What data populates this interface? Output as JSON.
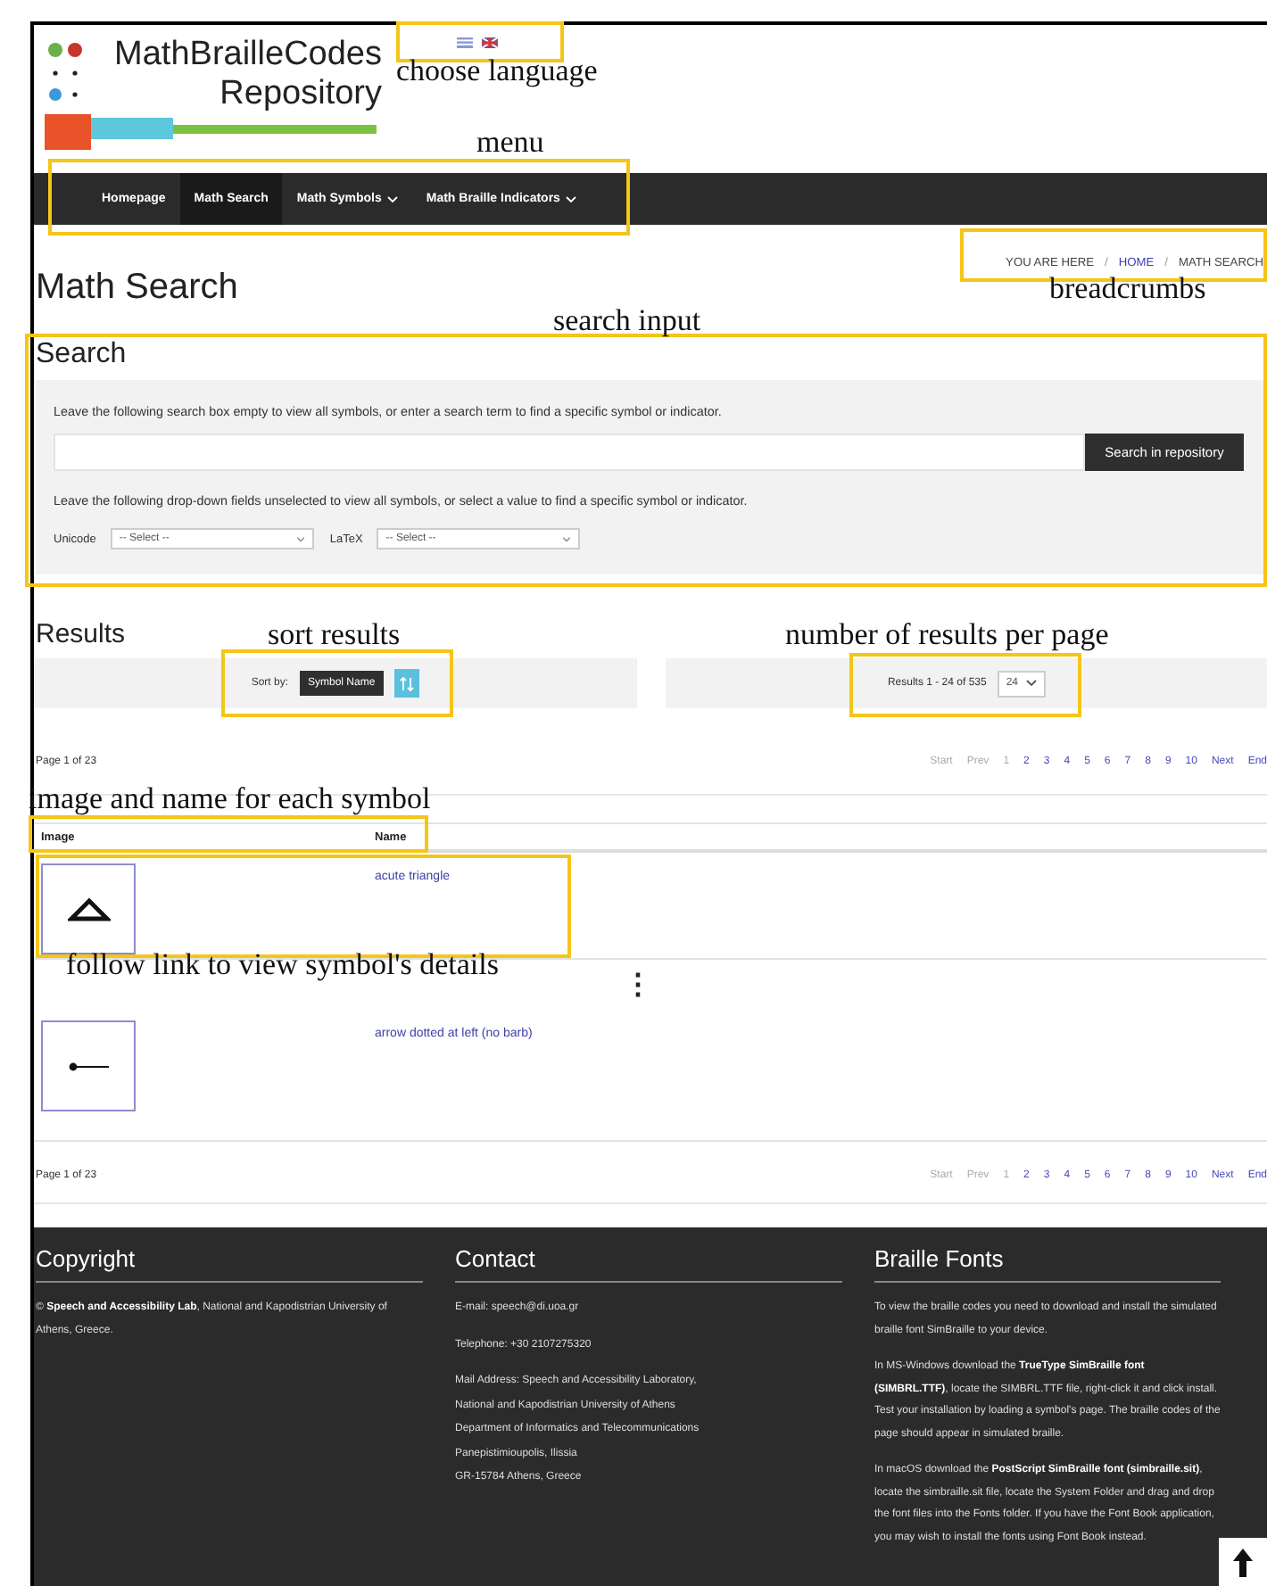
{
  "header": {
    "logo_line_1": "MathBrailleCodes",
    "logo_line_2": "Repository"
  },
  "nav": {
    "items": [
      {
        "label": "Homepage",
        "selected": false,
        "dropdown": false
      },
      {
        "label": "Math Search",
        "selected": true,
        "dropdown": false
      },
      {
        "label": "Math Symbols",
        "selected": false,
        "dropdown": true
      },
      {
        "label": "Math Braille Indicators",
        "selected": false,
        "dropdown": true
      }
    ]
  },
  "breadcrumbs": {
    "prefix": "YOU ARE HERE",
    "items": [
      {
        "label": "/",
        "kind": "separator"
      },
      {
        "label": "HOME",
        "kind": "link"
      },
      {
        "label": "/",
        "kind": "separator"
      },
      {
        "label": "MATH SEARCH",
        "kind": "current"
      }
    ]
  },
  "page_title": "Math Search",
  "search": {
    "title": "Search",
    "hint_1": "Leave the following search box empty to view all symbols, or enter a search term to find a specific symbol or indicator.",
    "button": "Search in repository",
    "hint_2": "Leave the following drop-down fields unselected to view all symbols, or select a value to find a specific symbol or indicator.",
    "filters": [
      {
        "label": "Unicode",
        "value": "-- Select --"
      },
      {
        "label": "LaTeX",
        "value": "-- Select --"
      }
    ]
  },
  "results": {
    "title": "Results",
    "sort_label": "Sort by:",
    "sort_button": "Symbol Name",
    "count": "Results 1 - 24 of 535",
    "per_page": "24",
    "pager_top": {
      "page_info": "Page 1 of 23",
      "items": [
        {
          "label": "Start",
          "disabled": true
        },
        {
          "label": "Prev",
          "disabled": true
        },
        {
          "label": "1",
          "disabled": true
        },
        {
          "label": "2",
          "disabled": false
        },
        {
          "label": "3",
          "disabled": false
        },
        {
          "label": "4",
          "disabled": false
        },
        {
          "label": "5",
          "disabled": false
        },
        {
          "label": "6",
          "disabled": false
        },
        {
          "label": "7",
          "disabled": false
        },
        {
          "label": "8",
          "disabled": false
        },
        {
          "label": "9",
          "disabled": false
        },
        {
          "label": "10",
          "disabled": false
        },
        {
          "label": "Next",
          "disabled": false
        },
        {
          "label": "End",
          "disabled": false
        }
      ]
    },
    "columns": [
      "Image",
      "Name"
    ],
    "rows": [
      {
        "name": "acute triangle"
      },
      {
        "name": "arrow dotted at left (no barb)"
      }
    ],
    "more_rows_marker": "⋮",
    "pager_bottom": {
      "page_info": "Page 1 of 23",
      "items": [
        {
          "label": "Start",
          "disabled": true
        },
        {
          "label": "Prev",
          "disabled": true
        },
        {
          "label": "1",
          "disabled": true
        },
        {
          "label": "2",
          "disabled": false
        },
        {
          "label": "3",
          "disabled": false
        },
        {
          "label": "4",
          "disabled": false
        },
        {
          "label": "5",
          "disabled": false
        },
        {
          "label": "6",
          "disabled": false
        },
        {
          "label": "7",
          "disabled": false
        },
        {
          "label": "8",
          "disabled": false
        },
        {
          "label": "9",
          "disabled": false
        },
        {
          "label": "10",
          "disabled": false
        },
        {
          "label": "Next",
          "disabled": false
        },
        {
          "label": "End",
          "disabled": false
        }
      ]
    }
  },
  "footer": {
    "copyright": {
      "title": "Copyright",
      "text": "© **Speech and Accessibility Lab**, National and Kapodistrian University of Athens, Greece."
    },
    "contact": {
      "title": "Contact",
      "email": "E-mail: speech@di.uoa.gr",
      "telephone": "Telephone: +30 2107275320",
      "address_lines": [
        "Mail Address: Speech and Accessibility Laboratory,",
        "National and Kapodistrian University of Athens",
        "Department of Informatics and Telecommunications",
        "Panepistimioupolis, Ilissia",
        "GR-15784 Athens, Greece"
      ]
    },
    "fonts": {
      "title": "Braille Fonts",
      "paragraphs": [
        "To view the braille codes you need to download and install the simulated braille font SimBraille to your device.",
        "In MS-Windows download the **TrueType SimBraille font (SIMBRL.TTF)**, locate the SIMBRL.TTF file, right-click it and click install. Test your installation by loading a symbol's page. The braille codes of the page should appear in simulated braille.",
        "In macOS download the **PostScript SimBraille font (simbraille.sit)**, locate the simbraille.sit file, locate the System Folder and drag and drop the font files into the Fonts folder. If you have the Font Book application, you may wish to install the fonts using Font Book instead."
      ]
    }
  },
  "annotations": [
    {
      "text": "choose language"
    },
    {
      "text": "menu"
    },
    {
      "text": "breadcrumbs"
    },
    {
      "text": "search input"
    },
    {
      "text": "sort results"
    },
    {
      "text": "number of results per page"
    },
    {
      "text": "image and name for each symbol"
    },
    {
      "text": "follow link to view symbol's details"
    }
  ]
}
